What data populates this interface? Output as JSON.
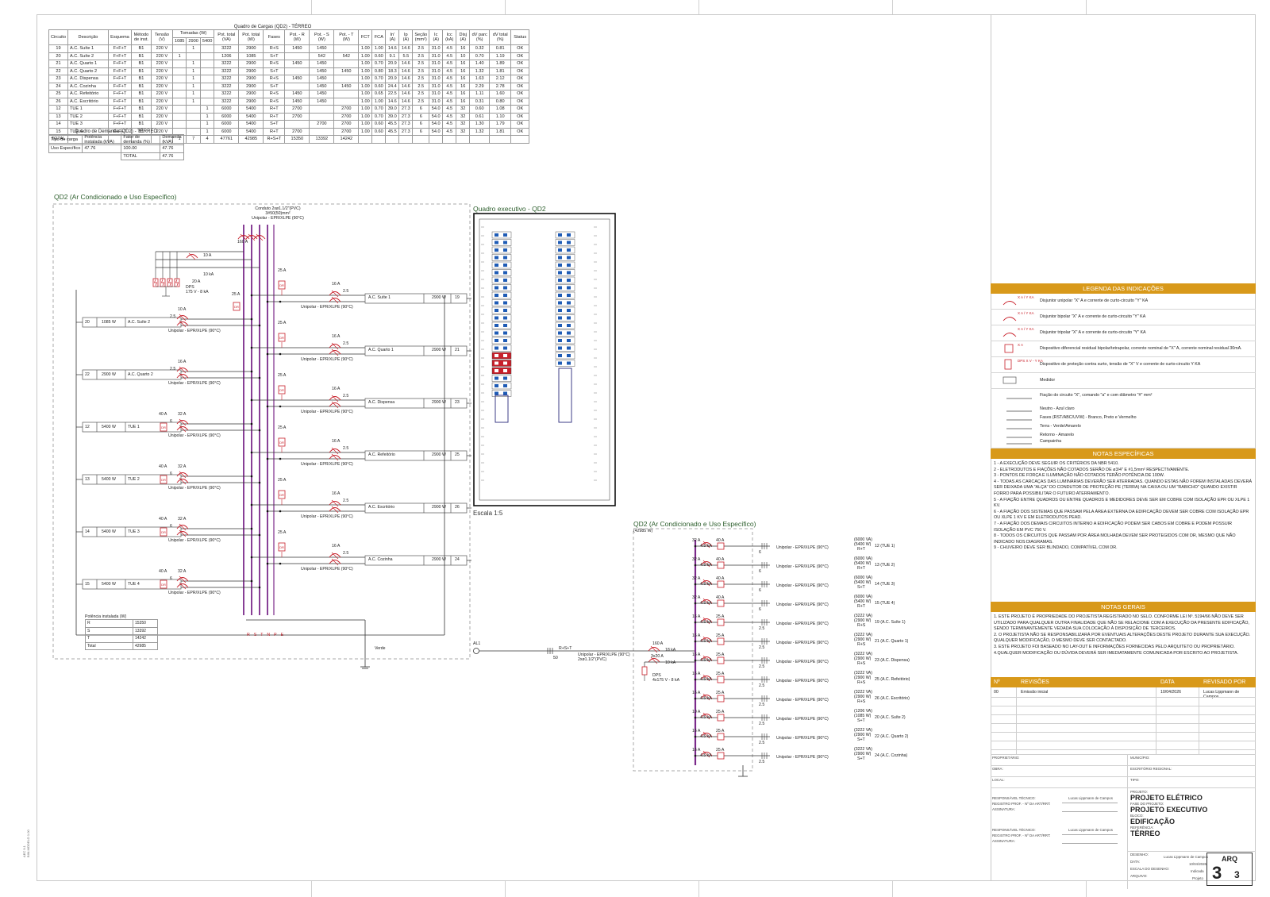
{
  "load_table": {
    "title": "Quadro de Cargas (QD2) - TÉRREO",
    "headers": [
      "Circuito",
      "Descrição",
      "Esquema",
      "Método de inst.",
      "Tensão (V)",
      "Tomadas (W)",
      "",
      "",
      "Pot. total (VA)",
      "Pot. total (W)",
      "Fases",
      "Pot. - R (W)",
      "Pot. - S (W)",
      "Pot. - T (W)",
      "FCT",
      "FCA",
      "In' (A)",
      "Ip (A)",
      "Seção (mm²)",
      "Ic (A)",
      "Icc (kA)",
      "Disj (A)",
      "dV parc (%)",
      "dV total (%)",
      "Status"
    ],
    "tomadas_sub": [
      "1085",
      "2900",
      "5400"
    ],
    "rows": [
      [
        "19",
        "A.C. Suíte 1",
        "F+F+T",
        "B1",
        "220 V",
        "",
        "1",
        "",
        "3222",
        "2900",
        "R+S",
        "1450",
        "1450",
        "",
        "1.00",
        "1.00",
        "14.6",
        "14.6",
        "2.5",
        "31.0",
        "4.5",
        "16",
        "0.32",
        "0.81",
        "OK"
      ],
      [
        "20",
        "A.C. Suíte 2",
        "F+F+T",
        "B1",
        "220 V",
        "1",
        "",
        "",
        "1206",
        "1085",
        "S+T",
        "",
        "542",
        "542",
        "1.00",
        "0.60",
        "9.1",
        "5.5",
        "2.5",
        "31.0",
        "4.5",
        "10",
        "0.70",
        "1.19",
        "OK"
      ],
      [
        "21",
        "A.C. Quarto 1",
        "F+F+T",
        "B1",
        "220 V",
        "",
        "1",
        "",
        "3222",
        "2900",
        "R+S",
        "1450",
        "1450",
        "",
        "1.00",
        "0.70",
        "20.9",
        "14.6",
        "2.5",
        "31.0",
        "4.5",
        "16",
        "1.40",
        "1.89",
        "OK"
      ],
      [
        "22",
        "A.C. Quarto 2",
        "F+F+T",
        "B1",
        "220 V",
        "",
        "1",
        "",
        "3222",
        "2900",
        "S+T",
        "",
        "1450",
        "1450",
        "1.00",
        "0.80",
        "18.3",
        "14.6",
        "2.5",
        "31.0",
        "4.5",
        "16",
        "1.32",
        "1.81",
        "OK"
      ],
      [
        "23",
        "A.C. Dispensa",
        "F+F+T",
        "B1",
        "220 V",
        "",
        "1",
        "",
        "3222",
        "2900",
        "R+S",
        "1450",
        "1450",
        "",
        "1.00",
        "0.70",
        "20.9",
        "14.6",
        "2.5",
        "31.0",
        "4.5",
        "16",
        "1.63",
        "2.12",
        "OK"
      ],
      [
        "24",
        "A.C. Cozinha",
        "F+F+T",
        "B1",
        "220 V",
        "",
        "1",
        "",
        "3222",
        "2900",
        "S+T",
        "",
        "1450",
        "1450",
        "1.00",
        "0.60",
        "24.4",
        "14.6",
        "2.5",
        "31.0",
        "4.5",
        "16",
        "2.29",
        "2.78",
        "OK"
      ],
      [
        "25",
        "A.C. Refeitório",
        "F+F+T",
        "B1",
        "220 V",
        "",
        "1",
        "",
        "3222",
        "2900",
        "R+S",
        "1450",
        "1450",
        "",
        "1.00",
        "0.65",
        "22.5",
        "14.6",
        "2.5",
        "31.0",
        "4.5",
        "16",
        "1.11",
        "1.60",
        "OK"
      ],
      [
        "26",
        "A.C. Escritório",
        "F+F+T",
        "B1",
        "220 V",
        "",
        "1",
        "",
        "3222",
        "2900",
        "R+S",
        "1450",
        "1450",
        "",
        "1.00",
        "1.00",
        "14.6",
        "14.6",
        "2.5",
        "31.0",
        "4.5",
        "16",
        "0.31",
        "0.80",
        "OK"
      ],
      [
        "12",
        "TUE 1",
        "F+F+T",
        "B1",
        "220 V",
        "",
        "",
        "1",
        "6000",
        "5400",
        "R+T",
        "2700",
        "",
        "2700",
        "1.00",
        "0.70",
        "39.0",
        "27.3",
        "6",
        "54.0",
        "4.5",
        "32",
        "0.60",
        "1.08",
        "OK"
      ],
      [
        "13",
        "TUE 2",
        "F+F+T",
        "B1",
        "220 V",
        "",
        "",
        "1",
        "6000",
        "5400",
        "R+T",
        "2700",
        "",
        "2700",
        "1.00",
        "0.70",
        "39.0",
        "27.3",
        "6",
        "54.0",
        "4.5",
        "32",
        "0.61",
        "1.10",
        "OK"
      ],
      [
        "14",
        "TUE 3",
        "F+F+T",
        "B1",
        "220 V",
        "",
        "",
        "1",
        "6000",
        "5400",
        "S+T",
        "",
        "2700",
        "2700",
        "1.00",
        "0.60",
        "45.5",
        "27.3",
        "6",
        "54.0",
        "4.5",
        "32",
        "1.30",
        "1.79",
        "OK"
      ],
      [
        "15",
        "TUE 4",
        "F+F+T",
        "B1",
        "220 V",
        "",
        "",
        "1",
        "6000",
        "5400",
        "R+T",
        "2700",
        "",
        "2700",
        "1.00",
        "0.60",
        "45.5",
        "27.3",
        "6",
        "54.0",
        "4.5",
        "32",
        "1.32",
        "1.81",
        "OK"
      ]
    ],
    "total": [
      "TOTAL",
      "",
      "",
      "",
      "",
      "1",
      "7",
      "4",
      "47761",
      "42985",
      "R+S+T",
      "15350",
      "13392",
      "14242",
      "",
      "",
      "",
      "",
      "",
      "",
      "",
      "",
      "",
      "",
      ""
    ]
  },
  "demand_table": {
    "title": "Quadro de Demanda (QD2) - TÉRREO",
    "headers": [
      "Tipo de carga",
      "Potência instalada (kVA)",
      "Fator de demanda (%)",
      "Demanda (kVA)"
    ],
    "row": [
      "Uso Específico",
      "47.76",
      "100.00",
      "47.76"
    ],
    "total_label": "TOTAL",
    "total_value": "47.76"
  },
  "diagram_left": {
    "title": "QD2 (Ar Condicionado e Uso Específico)",
    "conduit": [
      "Conduto 2xø1.1/2\"(PVC)",
      "3#50(50)mm²",
      "Unipolar - EPR/XLPE (90°C)"
    ],
    "main_breaker": "160 A",
    "dps_breaker": [
      "10 A",
      "10 kA",
      "20 A"
    ],
    "dps_label": [
      "DPS",
      "175 V - 8 kA"
    ],
    "bus_labels": [
      "R",
      "S",
      "T",
      "N",
      "PE"
    ],
    "cable": "Unipolar - EPR/XLPE (90°C)",
    "dr": "25 A",
    "circuits_right": [
      {
        "breaker": "16 A",
        "ka": "2.5",
        "name": "A.C. Suíte 1",
        "power": "2900 W",
        "num": "19"
      },
      {
        "breaker": "16 A",
        "ka": "2.5",
        "name": "A.C. Quarto 1",
        "power": "2900 W",
        "num": "21"
      },
      {
        "breaker": "16 A",
        "ka": "2.5",
        "name": "A.C. Dispensa",
        "power": "2900 W",
        "num": "23"
      },
      {
        "breaker": "16 A",
        "ka": "2.5",
        "name": "A.C. Refeitório",
        "power": "2900 W",
        "num": "25"
      },
      {
        "breaker": "16 A",
        "ka": "2.5",
        "name": "A.C. Escritório",
        "power": "2900 W",
        "num": "26"
      },
      {
        "breaker": "16 A",
        "ka": "2.5",
        "name": "A.C. Cozinha",
        "power": "2900 W",
        "num": "24"
      }
    ],
    "circuits_left": [
      {
        "breaker": "10 A",
        "ka": "2.5",
        "name": "A.C. Suíte 2",
        "power": "1085 W",
        "num": "20",
        "dr": ""
      },
      {
        "breaker": "16 A",
        "ka": "2.5",
        "name": "A.C. Quarto 2",
        "power": "2900 W",
        "num": "22",
        "dr": ""
      },
      {
        "breaker": "32 A",
        "ka": "6",
        "name": "TUE 1",
        "power": "5400 W",
        "num": "12",
        "dr": "40 A"
      },
      {
        "breaker": "32 A",
        "ka": "6",
        "name": "TUE 2",
        "power": "5400 W",
        "num": "13",
        "dr": "40 A"
      },
      {
        "breaker": "32 A",
        "ka": "6",
        "name": "TUE 3",
        "power": "5400 W",
        "num": "14",
        "dr": "40 A"
      },
      {
        "breaker": "32 A",
        "ka": "6",
        "name": "TUE 4",
        "power": "5400 W",
        "num": "15",
        "dr": "40 A"
      }
    ],
    "power_table": {
      "title": "Potência instalada (W)",
      "rows": [
        [
          "R",
          "15350"
        ],
        [
          "S",
          "13392"
        ],
        [
          "T",
          "14242"
        ],
        [
          "Total",
          "42985"
        ]
      ]
    },
    "ground": "Verde"
  },
  "exec_panel": {
    "title": "Quadro executivo - QD2",
    "scale": "Escala 1:5"
  },
  "diagram_right": {
    "title": "QD2 (Ar Condicionado e Uso Específico)",
    "subtitle": "(42985 W)",
    "al_label": "AL1",
    "feed_label": [
      "R+S+T",
      "50"
    ],
    "feed_cable": [
      "Unipolar - EPR/XLPE (90°C)",
      "2xø1.1/2\"(PVC)"
    ],
    "main": [
      "160 A",
      "18 kA"
    ],
    "dps_breaker": [
      "3x20 A",
      "10 kA"
    ],
    "dps": [
      "DPS",
      "4x175 V - 8 kA"
    ],
    "cable": "Unipolar - EPR/XLPE (90°C)",
    "rows": [
      {
        "b": "32 A",
        "ka": "4.5 kA",
        "dr": "40 A",
        "sec": "6",
        "va": "(6000 VA)",
        "w": "(5400 W)",
        "ph": "R+T",
        "name": "12 (TUE 1)"
      },
      {
        "b": "32 A",
        "ka": "4.5 kA",
        "dr": "40 A",
        "sec": "6",
        "va": "(6000 VA)",
        "w": "(5400 W)",
        "ph": "R+T",
        "name": "13 (TUE 2)"
      },
      {
        "b": "32 A",
        "ka": "4.5 kA",
        "dr": "40 A",
        "sec": "6",
        "va": "(6000 VA)",
        "w": "(5400 W)",
        "ph": "S+T",
        "name": "14 (TUE 3)"
      },
      {
        "b": "32 A",
        "ka": "4.5 kA",
        "dr": "40 A",
        "sec": "6",
        "va": "(6000 VA)",
        "w": "(5400 W)",
        "ph": "R+T",
        "name": "15 (TUE 4)"
      },
      {
        "b": "16 A",
        "ka": "4.5 kA",
        "dr": "25 A",
        "sec": "2.5",
        "va": "(3222 VA)",
        "w": "(2900 W)",
        "ph": "R+S",
        "name": "19 (A.C. Suíte 1)"
      },
      {
        "b": "16 A",
        "ka": "4.5 kA",
        "dr": "25 A",
        "sec": "2.5",
        "va": "(3222 VA)",
        "w": "(2900 W)",
        "ph": "R+S",
        "name": "21 (A.C. Quarto 1)"
      },
      {
        "b": "16 A",
        "ka": "4.5 kA",
        "dr": "25 A",
        "sec": "2.5",
        "va": "(3222 VA)",
        "w": "(2900 W)",
        "ph": "R+S",
        "name": "23 (A.C. Dispensa)"
      },
      {
        "b": "16 A",
        "ka": "4.5 kA",
        "dr": "25 A",
        "sec": "2.5",
        "va": "(3222 VA)",
        "w": "(2900 W)",
        "ph": "R+S",
        "name": "25 (A.C. Refeitório)"
      },
      {
        "b": "16 A",
        "ka": "4.5 kA",
        "dr": "25 A",
        "sec": "2.5",
        "va": "(3222 VA)",
        "w": "(2900 W)",
        "ph": "R+S",
        "name": "26 (A.C. Escritório)"
      },
      {
        "b": "10 A",
        "ka": "4.5 kA",
        "dr": "25 A",
        "sec": "2.5",
        "va": "(1206 VA)",
        "w": "(1085 W)",
        "ph": "S+T",
        "name": "20 (A.C. Suíte 2)"
      },
      {
        "b": "16 A",
        "ka": "4.5 kA",
        "dr": "25 A",
        "sec": "2.5",
        "va": "(3222 VA)",
        "w": "(2900 W)",
        "ph": "S+T",
        "name": "22 (A.C. Quarto 2)"
      },
      {
        "b": "16 A",
        "ka": "4.5 kA",
        "dr": "25 A",
        "sec": "2.5",
        "va": "(3222 VA)",
        "w": "(2900 W)",
        "ph": "S+T",
        "name": "24 (A.C. Cozinha)"
      }
    ]
  },
  "legend": {
    "title": "LEGENDA DAS INDICAÇÕES",
    "items": [
      {
        "sym": "X A / Y KA",
        "text": "Disjuntor unipolar \"X\" A e corrente de curto-circuito \"Y\" KA"
      },
      {
        "sym": "X A / Y KA",
        "text": "Disjuntor bipolar \"X\" A e corrente de curto-circuito \"Y\" KA"
      },
      {
        "sym": "X A / Y KA",
        "text": "Disjuntor tripolar \"X\" A e corrente de curto-circuito \"Y\" KA"
      },
      {
        "sym": "X A",
        "text": "Dispositivo diferencial residual bipolar/tetrapolar, corrente nominal de \"X\" A, corrente nominal residual 30mA."
      },
      {
        "sym": "DPS X V - Y KA",
        "text": "Dispositivo de proteção contra surto, tensão de \"X\" V e corrente de curto-circuito Y KA"
      },
      {
        "sym": "",
        "text": "Medidor"
      }
    ],
    "wiring": [
      "Fiação do circuito \"X\", comando \"a\" e com diâmetro \"#\" mm²",
      "Neutro - Azul claro",
      "Fases (RST/ABC/UVW) - Branco, Preto e Vermelho",
      "Terra - Verde/Amarelo",
      "Retorno - Amarelo",
      "Campainha"
    ]
  },
  "specific_notes": {
    "title": "NOTAS ESPECÍFICAS",
    "lines": [
      "1 - A EXECUÇÃO DEVE SEGUIR OS CRITÉRIOS DA NBR 5410.",
      "2 - ELETRODUTOS E FIAÇÕES NÃO COTADOS SERÃO DE ø3/4\" E #1,5mm² RESPECTIVAMENTE.",
      "3 - PONTOS DE FORÇA E ILUMINAÇÃO NÃO COTADOS TERÃO POTÊNCIA DE 100W.",
      "4 - TODAS AS CARCAÇAS DAS LUMINÁRIAS DEVERÃO SER ATERRADAS. QUANDO ESTAS NÃO FOREM INSTALADAS DEVERÁ SER DEIXADA UMA \"ALÇA\" DO CONDUTOR DE PROTEÇÃO PE (TERRA) NA CAIXA OU UM \"RABICHO\" QUANDO EXISTIR FORRO PARA POSSIBILITAR O FUTURO ATERRAMENTO.",
      "5 - A FIAÇÃO ENTRE QUADROS OU ENTRE QUADROS E MEDIDORES DEVE SER EM COBRE COM ISOLAÇÃO EPR OU XLPE 1 KV.",
      "6 - A FIAÇÃO DOS SISTEMAS QUE PASSAM PELA ÁREA EXTERNA DA EDIFICAÇÃO DEVEM SER COBRE COM ISOLAÇÃO EPR OU XLPE 1 KV E EM ELETRODUTOS PEAD.",
      "7 - A FIAÇÃO DOS DEMAIS CIRCUITOS INTERNO A EDIFICAÇÃO PODEM SER CABOS EM COBRE E PODEM POSSUIR ISOLAÇÃO EM PVC 750 V.",
      "8 - TODOS OS CIRCUITOS QUE PASSAM POR ÁREA MOLHADA DEVEM SER PROTEGIDOS COM DR, MESMO QUE NÃO INDICADO NOS DIAGRAMAS.",
      "9 - CHUVEIRO DEVE SER BLINDADO, COMPATÍVEL COM DR."
    ]
  },
  "general_notes": {
    "title": "NOTAS GERAIS",
    "lines": [
      "1. ESTE PROJETO É PROPRIEDADE DO PROJETISTA REGISTRADO NO SELO. CONFORME LEI Nº. 5194/66 NÃO DEVE SER UTILIZADO PARA QUALQUER OUTRA FINALIDADE QUE NÃO SE RELACIONE COM A EXECUÇÃO DA PRESENTE EDIFICAÇÃO, SENDO TERMINANTEMENTE VEDADA SUA COLOCAÇÃO À DISPOSIÇÃO DE TERCEIROS.",
      "2. O PROJETISTA NÃO SE RESPONSABILIZARÁ POR EVENTUAIS ALTERAÇÕES DESTE PROJETO DURANTE SUA EXECUÇÃO. QUALQUER MODIFICAÇÃO, O MESMO DEVE SER CONTACTADO.",
      "3. ESTE PROJETO FOI BASEADO NO LAY-OUT E INFORMAÇÕES FORNECIDAS PELO ARQUITETO OU PROPRIETÁRIO.",
      "4.QUALQUER MODIFICAÇÃO OU DÚVIDA DEVERÁ SER IMEDIATAMENTE COMUNICADA POR ESCRITO AO PROJETISTA."
    ]
  },
  "revisions": {
    "headers": [
      "Nº",
      "REVISÕES",
      "DATA",
      "REVISADO POR"
    ],
    "rows": [
      [
        "00",
        "Emissão inicial",
        "10/04/2026",
        "Lucas Lippmann de Campos"
      ]
    ]
  },
  "title_block": {
    "proprietario": "PROPRIETÁRIO:",
    "municipio": "MUNICÍPIO:",
    "obra": "OBRA:",
    "escritorio": "ESCRITÓRIO REGIONAL:",
    "local": "LOCAL:",
    "tipo": "TIPO:",
    "resp1": [
      "RESPONSÁVEL TÉCNICO:",
      "REGISTRO PROF. - Nº DA ART/RRT:",
      "ASSINATURA:"
    ],
    "resp1_name": "Lucas Lippmann de Campos",
    "resp2": [
      "RESPONSÁVEL TÉCNICO:",
      "REGISTRO PROF. - Nº DA ART/RRT:",
      "ASSINATURA:"
    ],
    "resp2_name": "Lucas Lippmann de Campos",
    "projeto_lbl": "PROJETO:",
    "projeto": "PROJETO ELÉTRICO",
    "fase_lbl": "FASE DO PROJETO:",
    "fase": "PROJETO EXECUTIVO",
    "bloco_lbl": "BLOCO:",
    "bloco": "EDIFICAÇÃO",
    "ref_lbl": "REFERÊNCIA:",
    "ref": "TÉRREO",
    "desenho_lbl": "DESENHO:",
    "desenho": "Lucas Lippmann de Campos",
    "data_lbl": "DATA:",
    "data": "10/04/2026",
    "escala_lbl": "ESCALA DO DESENHO:",
    "escala": "Indicada",
    "arquivo_lbl": "ARQUIVO:",
    "arquivo": "Projeto",
    "sheet_code": "ARQ",
    "sheet_num": "3",
    "sheet_total": "3"
  },
  "margin_text": [
    "AEC 9.1",
    "BIM-MODELO 1.00"
  ]
}
